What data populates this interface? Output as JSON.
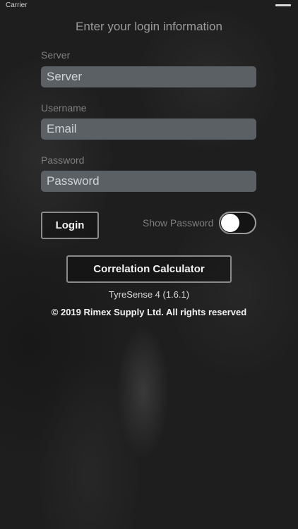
{
  "status_bar": {
    "carrier": "Carrier"
  },
  "header": {
    "title": "Enter your login information"
  },
  "form": {
    "server": {
      "label": "Server",
      "placeholder": "Server",
      "value": ""
    },
    "username": {
      "label": "Username",
      "placeholder": "Email",
      "value": ""
    },
    "password": {
      "label": "Password",
      "placeholder": "Password",
      "value": ""
    }
  },
  "actions": {
    "login_label": "Login",
    "show_password_label": "Show Password",
    "show_password_on": false,
    "correlation_label": "Correlation Calculator"
  },
  "footer": {
    "version": "TyreSense 4 (1.6.1)",
    "copyright": "© 2019 Rimex Supply Ltd. All rights reserved"
  },
  "colors": {
    "input_background": "#5b6064",
    "button_border": "#8a8a8a",
    "background": "#1e1e1e"
  }
}
